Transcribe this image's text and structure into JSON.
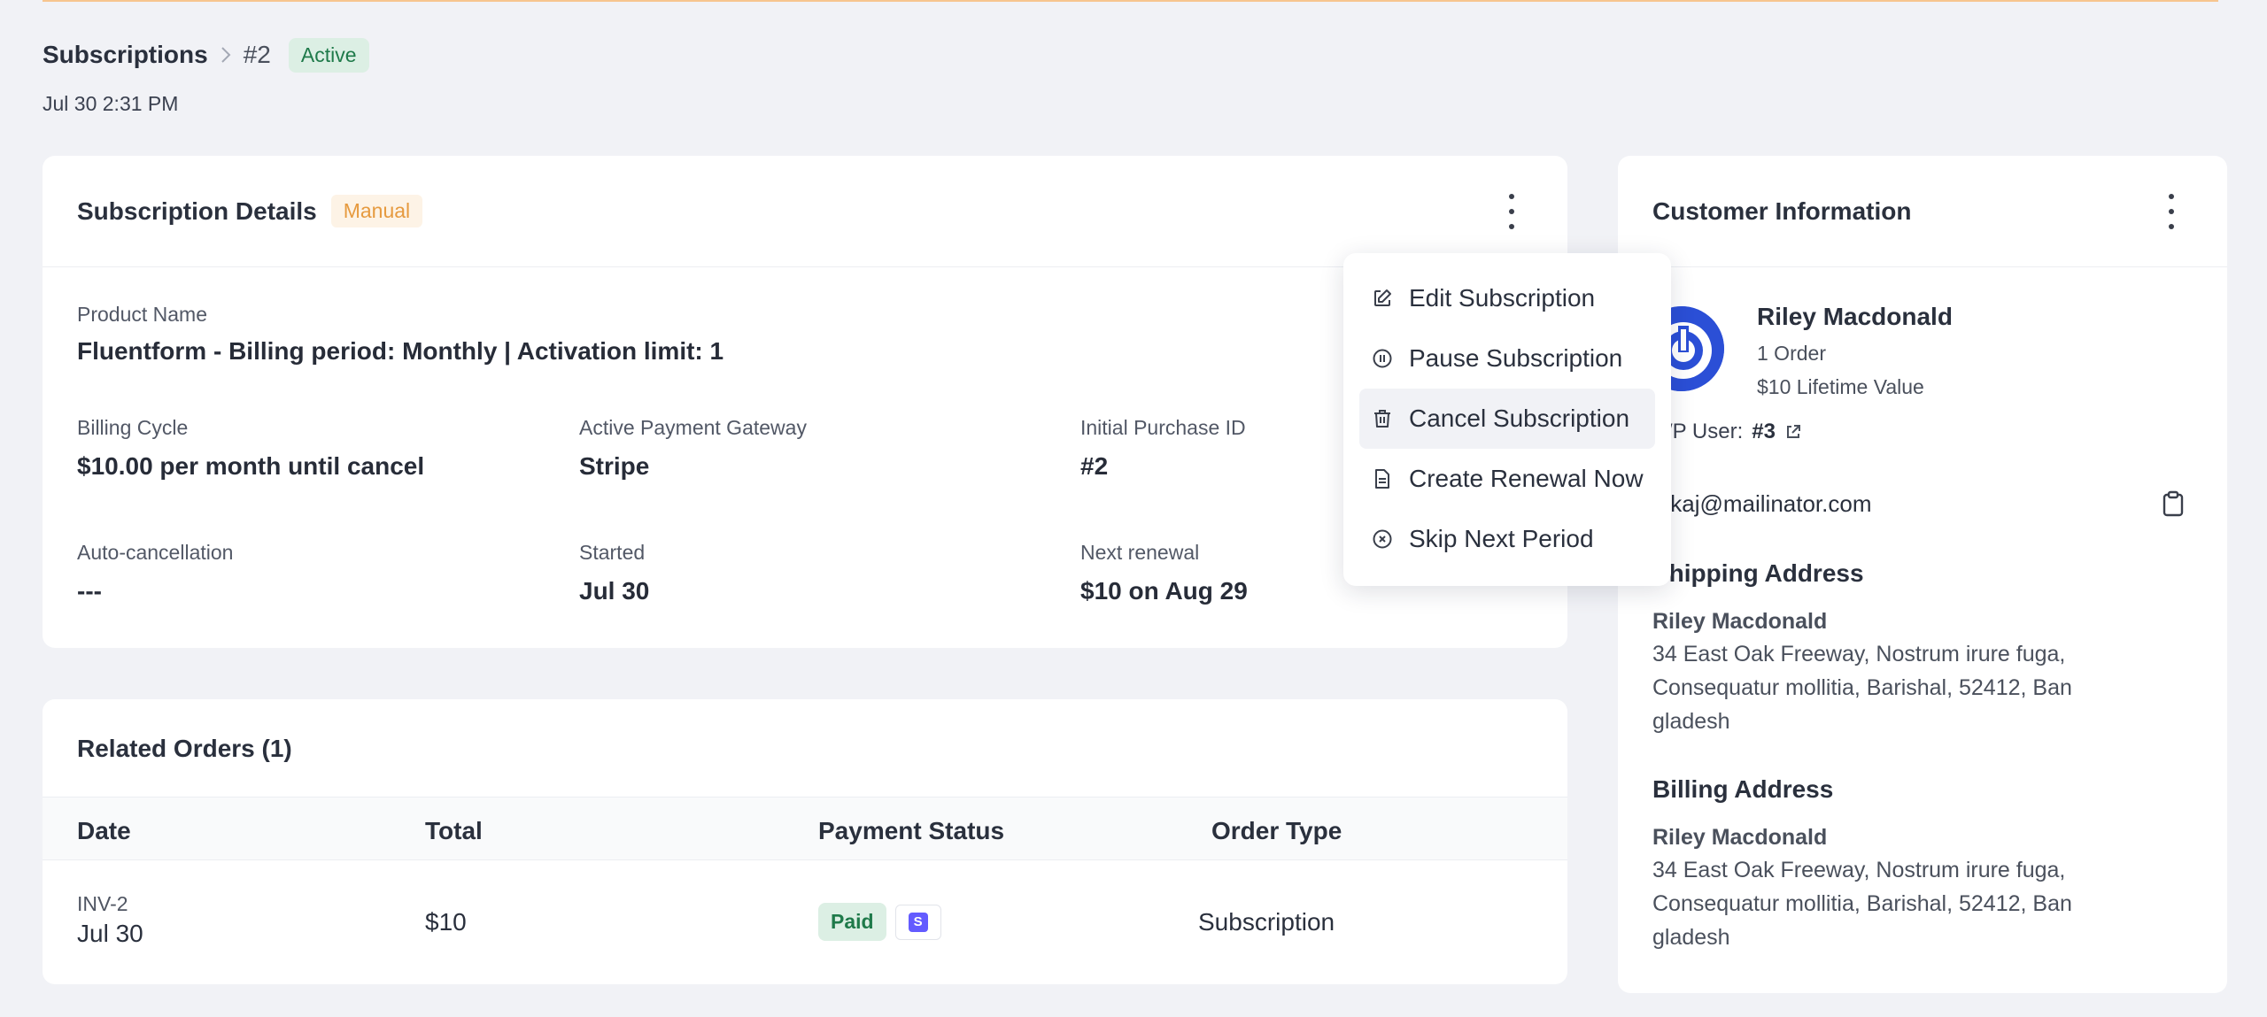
{
  "header": {
    "breadcrumb_root": "Subscriptions",
    "subscription_id": "#2",
    "status": "Active",
    "date": "Jul 30 2:31 PM"
  },
  "details": {
    "title": "Subscription Details",
    "mode_badge": "Manual",
    "product_label": "Product Name",
    "product_value": "Fluentform - Billing period: Monthly | Activation limit: 1",
    "fields": [
      {
        "label": "Billing Cycle",
        "value": "$10.00 per month until cancel"
      },
      {
        "label": "Active Payment Gateway",
        "value": "Stripe"
      },
      {
        "label": "Initial Purchase ID",
        "value": "#2"
      },
      {
        "label": "Auto-cancellation",
        "value": "---"
      },
      {
        "label": "Started",
        "value": "Jul 30"
      },
      {
        "label": "Next renewal",
        "value": "$10 on Aug 29"
      }
    ]
  },
  "menu": {
    "items": [
      {
        "label": "Edit Subscription",
        "icon": "edit-icon"
      },
      {
        "label": "Pause Subscription",
        "icon": "pause-icon"
      },
      {
        "label": "Cancel Subscription",
        "icon": "trash-icon"
      },
      {
        "label": "Create Renewal Now",
        "icon": "document-icon"
      },
      {
        "label": "Skip Next Period",
        "icon": "close-circle-icon"
      }
    ]
  },
  "orders": {
    "title": "Related Orders (1)",
    "columns": [
      "Date",
      "Total",
      "Payment Status",
      "Order Type"
    ],
    "rows": [
      {
        "invoice": "INV-2",
        "date": "Jul 30",
        "total": "$10",
        "payment_status": "Paid",
        "gateway_letter": "S",
        "order_type": "Subscription"
      }
    ]
  },
  "customer": {
    "title": "Customer Information",
    "name": "Riley Macdonald",
    "orders": "1 Order",
    "lifetime_value": "$10 Lifetime Value",
    "wp_user_label": "WP User:",
    "wp_user_value": "#3",
    "email": "jekaj@mailinator.com",
    "shipping_title": "Shipping Address",
    "shipping_name": "Riley Macdonald",
    "shipping_address": "34 East Oak Freeway, Nostrum irure fuga, Consequatur mollitia, Barishal, 52412, Ban gladesh",
    "billing_title": "Billing Address",
    "billing_name": "Riley Macdonald",
    "billing_address": "34 East Oak Freeway, Nostrum irure fuga, Consequatur mollitia, Barishal, 52412, Ban gladesh"
  },
  "colors": {
    "accent_line": "#f7c58f",
    "active_badge_bg": "#dcefe4",
    "active_badge_text": "#1f7a4a",
    "manual_badge_bg": "#fdf3e6",
    "manual_badge_text": "#e69a3f",
    "avatar_blue": "#2b4fd6",
    "stripe": "#635bff"
  }
}
